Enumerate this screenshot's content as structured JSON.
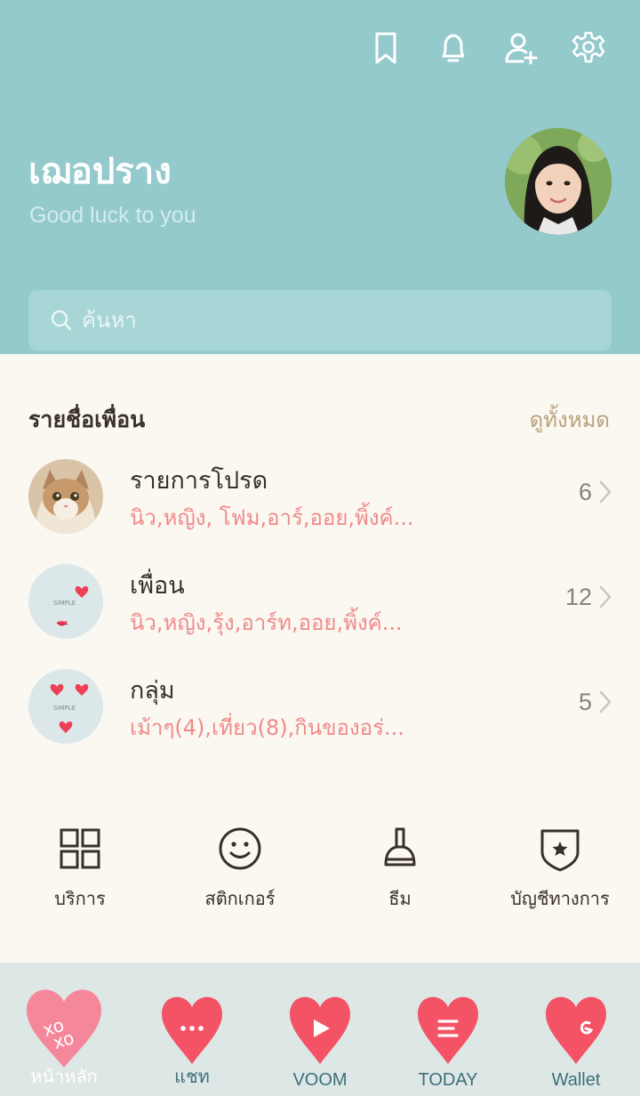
{
  "header": {
    "icons": [
      "bookmark-icon",
      "bell-icon",
      "add-friend-icon",
      "settings-icon"
    ],
    "bg_color": "#95cacd"
  },
  "profile": {
    "name": "เฌอปราง",
    "status": "Good luck to you"
  },
  "search": {
    "placeholder": "ค้นหา"
  },
  "friends": {
    "title": "รายชื่อเพื่อน",
    "see_all": "ดูทั้งหมด",
    "rows": [
      {
        "title": "รายการโปรด",
        "subtitle": "นิว,หญิง, โฟม,อาร์,ออย,พิ้งค์...",
        "count": "6"
      },
      {
        "title": "เพื่อน",
        "subtitle": "นิว,หญิง,รุ้ง,อาร์ท,ออย,พิ้งค์...",
        "count": "12"
      },
      {
        "title": "กลุ่ม",
        "subtitle": "เม้าๆ(4),เที่ยว(8),กินของอร่...",
        "count": "5"
      }
    ]
  },
  "quick_menu": [
    {
      "label": "บริการ",
      "icon": "grid-icon"
    },
    {
      "label": "สติกเกอร์",
      "icon": "smiley-icon"
    },
    {
      "label": "ธีม",
      "icon": "brush-icon"
    },
    {
      "label": "บัญชีทางการ",
      "icon": "shield-star-icon"
    }
  ],
  "bottom_nav": [
    {
      "label": "หน้าหลัก",
      "icon": "heart-xoxo-icon",
      "active": true
    },
    {
      "label": "แชท",
      "icon": "heart-chat-icon",
      "active": false
    },
    {
      "label": "VOOM",
      "icon": "heart-play-icon",
      "active": false
    },
    {
      "label": "TODAY",
      "icon": "heart-news-icon",
      "active": false
    },
    {
      "label": "Wallet",
      "icon": "heart-wallet-icon",
      "active": false
    }
  ],
  "colors": {
    "accent_pink": "#f08a8a",
    "heart_red": "#f45366",
    "heart_active": "#f5879a",
    "text_dark": "#3a302a"
  }
}
